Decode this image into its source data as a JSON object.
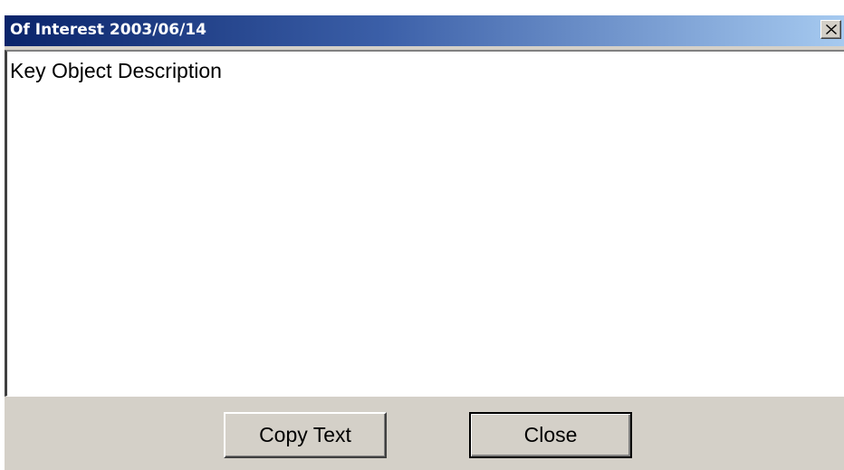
{
  "window": {
    "title": "Of Interest  2003/06/14",
    "close_icon": "close-x-icon"
  },
  "content": {
    "text": "Key Object Description"
  },
  "buttons": {
    "copy_label": "Copy Text",
    "close_label": "Close"
  },
  "colors": {
    "titlebar_start": "#0a246a",
    "titlebar_end": "#a6caf0",
    "window_bg": "#d4d0c8",
    "textarea_bg": "#ffffff"
  }
}
